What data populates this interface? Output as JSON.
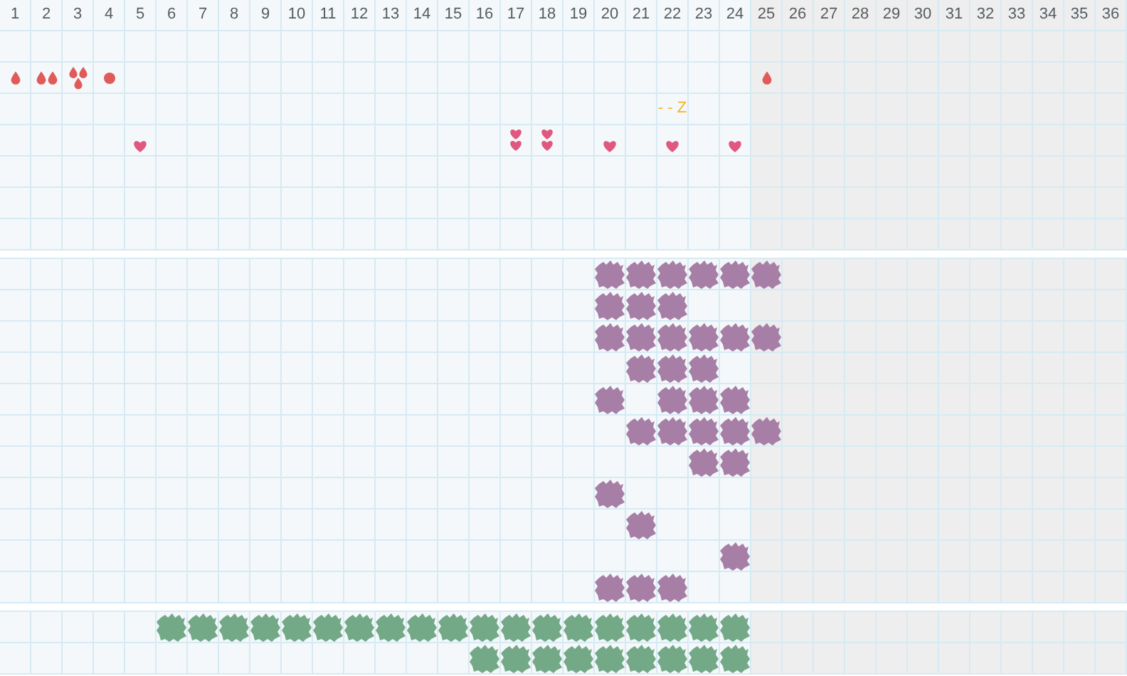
{
  "days": [
    {
      "label": "1",
      "shaded": false
    },
    {
      "label": "2",
      "shaded": false
    },
    {
      "label": "3",
      "shaded": false
    },
    {
      "label": "4",
      "shaded": false
    },
    {
      "label": "5",
      "shaded": false
    },
    {
      "label": "6",
      "shaded": false
    },
    {
      "label": "7",
      "shaded": false
    },
    {
      "label": "8",
      "shaded": false
    },
    {
      "label": "9",
      "shaded": false
    },
    {
      "label": "10",
      "shaded": false
    },
    {
      "label": "11",
      "shaded": false
    },
    {
      "label": "12",
      "shaded": false
    },
    {
      "label": "13",
      "shaded": false
    },
    {
      "label": "14",
      "shaded": false
    },
    {
      "label": "15",
      "shaded": false
    },
    {
      "label": "16",
      "shaded": false
    },
    {
      "label": "17",
      "shaded": false
    },
    {
      "label": "18",
      "shaded": false
    },
    {
      "label": "19",
      "shaded": false
    },
    {
      "label": "20",
      "shaded": false
    },
    {
      "label": "21",
      "shaded": false
    },
    {
      "label": "22",
      "shaded": false
    },
    {
      "label": "23",
      "shaded": false
    },
    {
      "label": "24",
      "shaded": false
    },
    {
      "label": "25",
      "shaded": true
    },
    {
      "label": "26",
      "shaded": true
    },
    {
      "label": "27",
      "shaded": true
    },
    {
      "label": "28",
      "shaded": true
    },
    {
      "label": "29",
      "shaded": true
    },
    {
      "label": "30",
      "shaded": true
    },
    {
      "label": "31",
      "shaded": true
    },
    {
      "label": "32",
      "shaded": true
    },
    {
      "label": "33",
      "shaded": true
    },
    {
      "label": "34",
      "shaded": true
    },
    {
      "label": "35",
      "shaded": true
    },
    {
      "label": "36",
      "shaded": true
    }
  ],
  "sections": [
    {
      "color": "#e05a5a",
      "rows": [
        {
          "cells": [
            null
          ]
        },
        {
          "cells": [
            {
              "kind": "drop"
            },
            {
              "kind": "drops-2"
            },
            {
              "kind": "drops-3"
            },
            {
              "kind": "spot"
            },
            null,
            null,
            null,
            null,
            null,
            null,
            null,
            null,
            null,
            null,
            null,
            null,
            null,
            null,
            null,
            null,
            null,
            null,
            null,
            null,
            {
              "kind": "drop"
            }
          ]
        },
        {
          "cells": [
            null,
            null,
            null,
            null,
            null,
            null,
            null,
            null,
            null,
            null,
            null,
            null,
            null,
            null,
            null,
            null,
            null,
            null,
            null,
            null,
            null,
            {
              "kind": "sleep",
              "text": "- - Z"
            }
          ]
        },
        {
          "cells": [
            null,
            null,
            null,
            null,
            {
              "kind": "heart"
            },
            null,
            null,
            null,
            null,
            null,
            null,
            null,
            null,
            null,
            null,
            null,
            {
              "kind": "hearts-2"
            },
            {
              "kind": "hearts-2"
            },
            null,
            {
              "kind": "heart"
            },
            null,
            {
              "kind": "heart"
            },
            null,
            {
              "kind": "heart"
            }
          ]
        },
        {
          "cells": [
            null
          ]
        },
        {
          "cells": [
            null
          ]
        },
        {
          "cells": [
            null
          ]
        }
      ]
    },
    {
      "color": "#a77fa6",
      "rows": [
        {
          "cells": [
            null,
            null,
            null,
            null,
            null,
            null,
            null,
            null,
            null,
            null,
            null,
            null,
            null,
            null,
            null,
            null,
            null,
            null,
            null,
            {
              "kind": "blob"
            },
            {
              "kind": "blob"
            },
            {
              "kind": "blob"
            },
            {
              "kind": "blob"
            },
            {
              "kind": "blob"
            },
            {
              "kind": "blob"
            }
          ]
        },
        {
          "cells": [
            null,
            null,
            null,
            null,
            null,
            null,
            null,
            null,
            null,
            null,
            null,
            null,
            null,
            null,
            null,
            null,
            null,
            null,
            null,
            {
              "kind": "blob"
            },
            {
              "kind": "blob"
            },
            {
              "kind": "blob"
            }
          ]
        },
        {
          "cells": [
            null,
            null,
            null,
            null,
            null,
            null,
            null,
            null,
            null,
            null,
            null,
            null,
            null,
            null,
            null,
            null,
            null,
            null,
            null,
            {
              "kind": "blob"
            },
            {
              "kind": "blob"
            },
            {
              "kind": "blob"
            },
            {
              "kind": "blob"
            },
            {
              "kind": "blob"
            },
            {
              "kind": "blob"
            }
          ]
        },
        {
          "cells": [
            null,
            null,
            null,
            null,
            null,
            null,
            null,
            null,
            null,
            null,
            null,
            null,
            null,
            null,
            null,
            null,
            null,
            null,
            null,
            null,
            {
              "kind": "blob"
            },
            {
              "kind": "blob"
            },
            {
              "kind": "blob"
            }
          ]
        },
        {
          "cells": [
            null,
            null,
            null,
            null,
            null,
            null,
            null,
            null,
            null,
            null,
            null,
            null,
            null,
            null,
            null,
            null,
            null,
            null,
            null,
            {
              "kind": "blob"
            },
            null,
            {
              "kind": "blob"
            },
            {
              "kind": "blob"
            },
            {
              "kind": "blob"
            }
          ]
        },
        {
          "cells": [
            null,
            null,
            null,
            null,
            null,
            null,
            null,
            null,
            null,
            null,
            null,
            null,
            null,
            null,
            null,
            null,
            null,
            null,
            null,
            null,
            {
              "kind": "blob"
            },
            {
              "kind": "blob"
            },
            {
              "kind": "blob"
            },
            {
              "kind": "blob"
            },
            {
              "kind": "blob"
            }
          ]
        },
        {
          "cells": [
            null,
            null,
            null,
            null,
            null,
            null,
            null,
            null,
            null,
            null,
            null,
            null,
            null,
            null,
            null,
            null,
            null,
            null,
            null,
            null,
            null,
            null,
            {
              "kind": "blob"
            },
            {
              "kind": "blob"
            }
          ]
        },
        {
          "cells": [
            null,
            null,
            null,
            null,
            null,
            null,
            null,
            null,
            null,
            null,
            null,
            null,
            null,
            null,
            null,
            null,
            null,
            null,
            null,
            {
              "kind": "blob"
            }
          ]
        },
        {
          "cells": [
            null,
            null,
            null,
            null,
            null,
            null,
            null,
            null,
            null,
            null,
            null,
            null,
            null,
            null,
            null,
            null,
            null,
            null,
            null,
            null,
            {
              "kind": "blob"
            }
          ]
        },
        {
          "cells": [
            null,
            null,
            null,
            null,
            null,
            null,
            null,
            null,
            null,
            null,
            null,
            null,
            null,
            null,
            null,
            null,
            null,
            null,
            null,
            null,
            null,
            null,
            null,
            {
              "kind": "blob"
            }
          ]
        },
        {
          "cells": [
            null,
            null,
            null,
            null,
            null,
            null,
            null,
            null,
            null,
            null,
            null,
            null,
            null,
            null,
            null,
            null,
            null,
            null,
            null,
            {
              "kind": "blob"
            },
            {
              "kind": "blob"
            },
            {
              "kind": "blob"
            }
          ]
        }
      ]
    },
    {
      "color": "#74a987",
      "rows": [
        {
          "cells": [
            null,
            null,
            null,
            null,
            null,
            {
              "kind": "blob"
            },
            {
              "kind": "blob"
            },
            {
              "kind": "blob"
            },
            {
              "kind": "blob"
            },
            {
              "kind": "blob"
            },
            {
              "kind": "blob"
            },
            {
              "kind": "blob"
            },
            {
              "kind": "blob"
            },
            {
              "kind": "blob"
            },
            {
              "kind": "blob"
            },
            {
              "kind": "blob"
            },
            {
              "kind": "blob"
            },
            {
              "kind": "blob"
            },
            {
              "kind": "blob"
            },
            {
              "kind": "blob"
            },
            {
              "kind": "blob"
            },
            {
              "kind": "blob"
            },
            {
              "kind": "blob"
            },
            {
              "kind": "blob"
            }
          ]
        },
        {
          "cells": [
            null,
            null,
            null,
            null,
            null,
            null,
            null,
            null,
            null,
            null,
            null,
            null,
            null,
            null,
            null,
            {
              "kind": "blob"
            },
            {
              "kind": "blob"
            },
            {
              "kind": "blob"
            },
            {
              "kind": "blob"
            },
            {
              "kind": "blob"
            },
            {
              "kind": "blob"
            },
            {
              "kind": "blob"
            },
            {
              "kind": "blob"
            },
            {
              "kind": "blob"
            }
          ]
        }
      ]
    }
  ]
}
